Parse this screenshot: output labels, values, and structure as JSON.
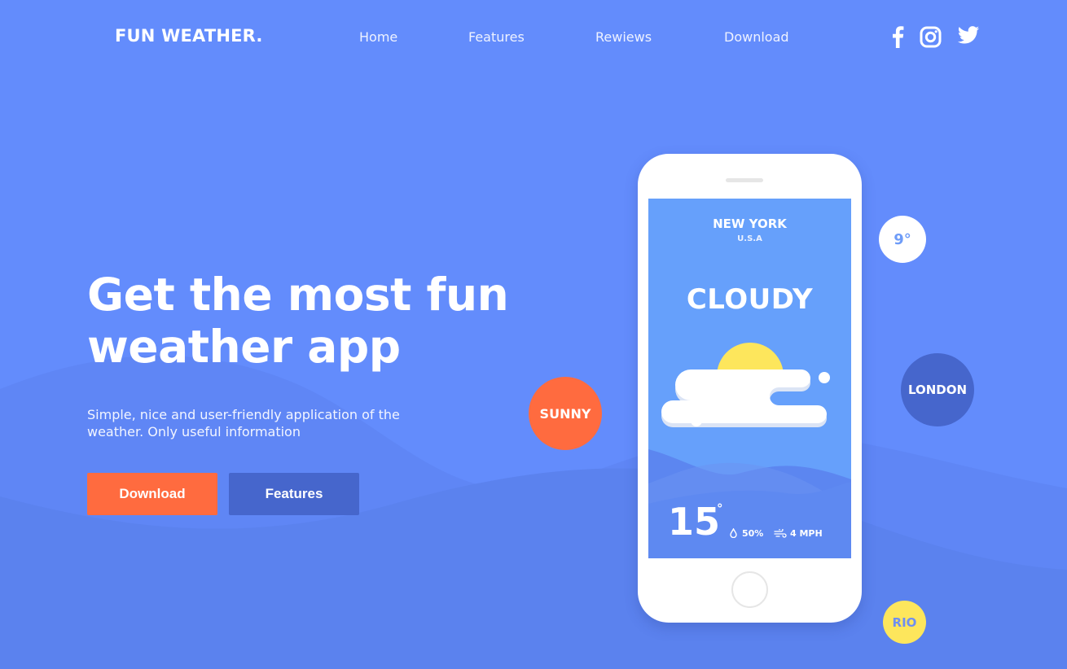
{
  "header": {
    "brand": "FUN WEATHER.",
    "nav": [
      {
        "label": "Home"
      },
      {
        "label": "Features"
      },
      {
        "label": "Rewiews"
      },
      {
        "label": "Download"
      }
    ],
    "social": [
      "facebook-icon",
      "instagram-icon",
      "twitter-icon"
    ]
  },
  "hero": {
    "title_line1": "Get the most fun",
    "title_line2": "weather app",
    "subtitle_line1": "Simple, nice and user-friendly application of the",
    "subtitle_line2": "weather. Only useful information",
    "download_label": "Download",
    "features_label": "Features"
  },
  "phone": {
    "city": "NEW YORK",
    "country": "U.S.A",
    "condition": "CLOUDY",
    "temperature": "15",
    "degree": "°",
    "humidity": "50%",
    "wind": "4 MPH"
  },
  "bubbles": {
    "sunny": "SUNNY",
    "temp": "9°",
    "london": "LONDON",
    "rio": "RIO"
  },
  "colors": {
    "background": "#638cfc",
    "accent_orange": "#ff6b3f",
    "accent_blue": "#4666cc",
    "sun_yellow": "#fde65c"
  }
}
